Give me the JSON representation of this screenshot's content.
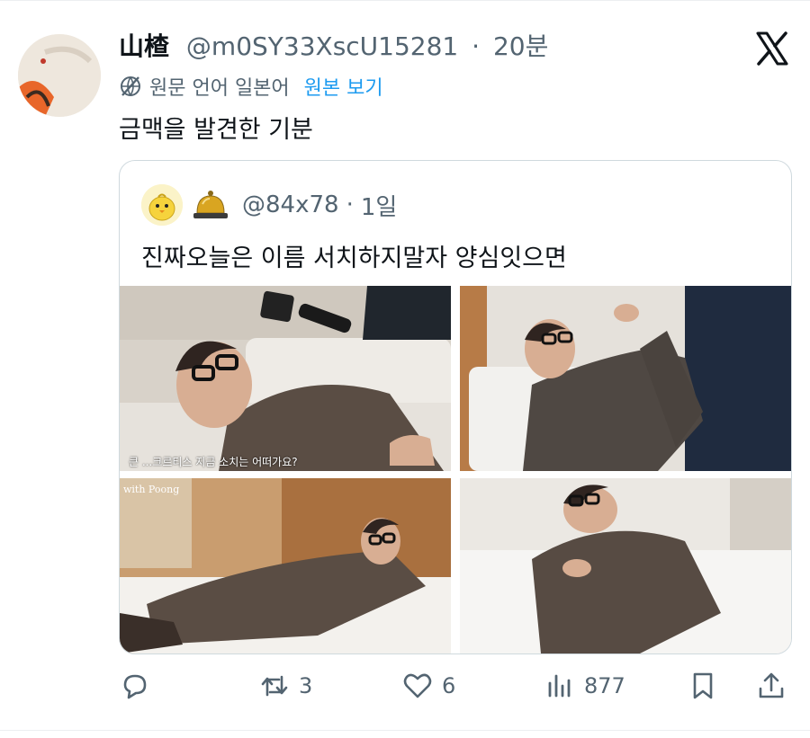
{
  "tweet": {
    "author_name": "山楂",
    "author_handle": "@m0SY33XscU15281",
    "separator": "·",
    "time": "20분",
    "translate_label": "원문 언어 일본어",
    "translate_link": "원본 보기",
    "text": "금맥을 발견한 기분"
  },
  "quote": {
    "handle": "@84x78",
    "separator": "·",
    "time": "1일",
    "text": "진짜오늘은 이름 서치하지말자 양심잇으면",
    "media": [
      {
        "name": "lying-on-couch-photo",
        "subtitle": "큰 ...크르티스 지금 소치는 어떠가요?"
      },
      {
        "name": "couch-leg-up-photo"
      },
      {
        "name": "hotel-bed-photo",
        "watermark": "with Poong"
      },
      {
        "name": "bed-close-photo"
      }
    ]
  },
  "actions": {
    "reply_count": "",
    "retweet_count": "3",
    "like_count": "6",
    "views_count": "877"
  },
  "icons": {
    "x_logo": "x-logo-icon",
    "translate": "globe-slash-icon",
    "reply": "reply-icon",
    "retweet": "retweet-icon",
    "like": "heart-icon",
    "views": "views-icon",
    "bookmark": "bookmark-icon",
    "share": "share-icon"
  },
  "colors": {
    "link": "#1d9bf0",
    "text": "#0f1419",
    "muted": "#536471",
    "border": "#cfd9de"
  }
}
